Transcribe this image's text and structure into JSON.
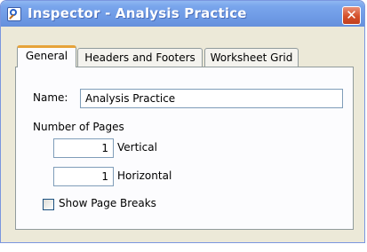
{
  "window": {
    "title": "Inspector - Analysis Practice",
    "close_glyph": "✕",
    "icon": "inspector-magnifier-icon"
  },
  "tabs": [
    {
      "label": "General",
      "active": true
    },
    {
      "label": "Headers and Footers",
      "active": false
    },
    {
      "label": "Worksheet Grid",
      "active": false
    }
  ],
  "general": {
    "name_label": "Name:",
    "name_value": "Analysis Practice",
    "pages_label": "Number of Pages",
    "vertical_value": "1",
    "vertical_label": "Vertical",
    "horizontal_value": "1",
    "horizontal_label": "Horizontal",
    "show_page_breaks_label": "Show Page Breaks",
    "show_page_breaks_checked": false
  },
  "colors": {
    "titlebar": "#7aa6ec",
    "active_tab_accent": "#e6a33a",
    "dialog_bg": "#ece9d8",
    "close_button": "#d4502a"
  }
}
